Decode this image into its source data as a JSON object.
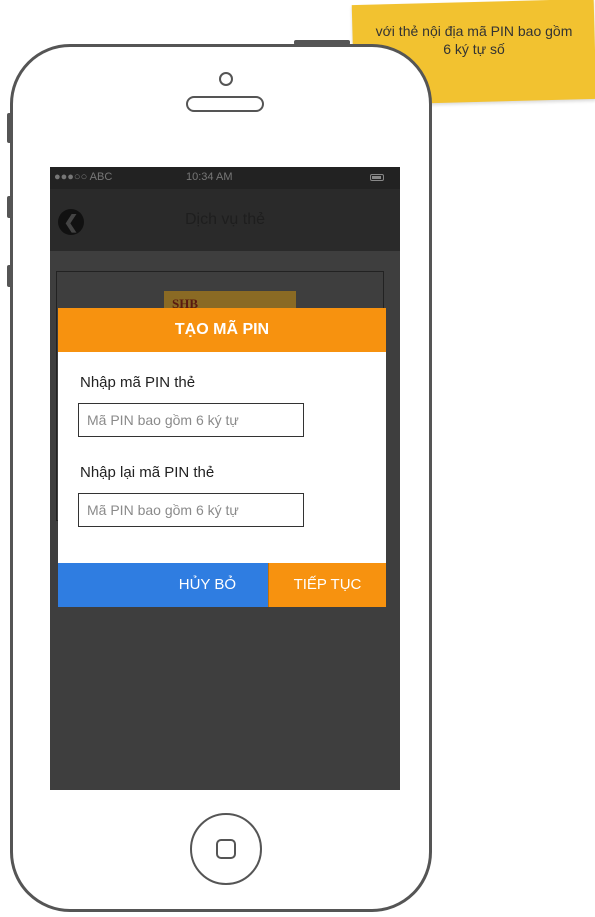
{
  "note": {
    "text": "với thẻ nội địa mã PIN bao gồm 6 ký tự số"
  },
  "statusbar": {
    "carrier": "●●●○○ ABC",
    "time": "10:34 AM"
  },
  "navbar": {
    "title": "Dịch vụ thẻ",
    "back_icon": "back-arrow-icon"
  },
  "card": {
    "bank_logo_text": "SHB"
  },
  "dialog": {
    "title": "TẠO MÃ PIN",
    "pin_label": "Nhập mã PIN thẻ",
    "pin_placeholder": "Mã PIN bao gồm 6 ký tự",
    "pin_confirm_label": "Nhập lại mã PIN thẻ",
    "pin_confirm_placeholder": "Mã PIN bao gồm 6 ký tự",
    "cancel_label": "HỦY BỎ",
    "continue_label": "TIẾP TỤC"
  },
  "colors": {
    "accent_orange": "#f7920f",
    "cancel_blue": "#2f7de1",
    "note_yellow": "#f2c230"
  }
}
